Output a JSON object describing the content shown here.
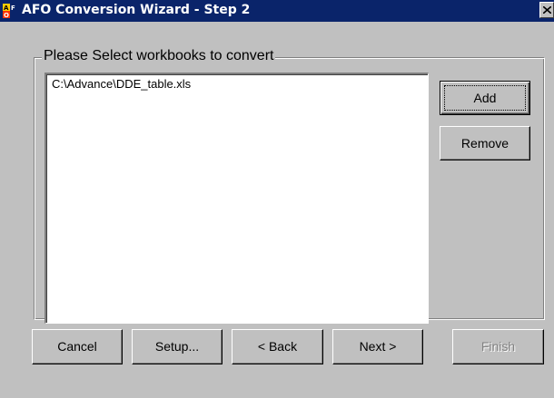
{
  "window": {
    "title": "AFO Conversion Wizard - Step 2",
    "icon": "afo-app-icon",
    "close_icon": "close-icon",
    "colors": {
      "titlebar": "#0a246a",
      "face": "#c0c0c0"
    }
  },
  "group": {
    "label": "Please Select workbooks to convert"
  },
  "workbooks": {
    "items": [
      "C:\\Advance\\DDE_table.xls"
    ]
  },
  "side_buttons": {
    "add": "Add",
    "remove": "Remove"
  },
  "nav_buttons": {
    "cancel": "Cancel",
    "setup": "Setup...",
    "back": "< Back",
    "next": "Next >",
    "finish": "Finish"
  }
}
